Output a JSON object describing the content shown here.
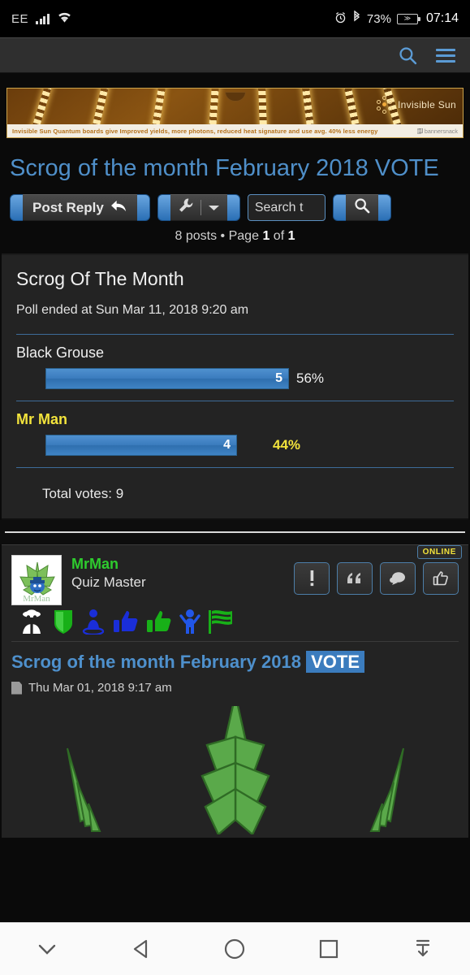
{
  "statusbar": {
    "carrier": "EE",
    "battery_percent": "73%",
    "clock": "07:14",
    "icons": [
      "signal-bars-icon",
      "wifi-icon",
      "alarm-icon",
      "bluetooth-icon",
      "battery-icon"
    ]
  },
  "navbar": {
    "search_icon": "search-icon",
    "menu_icon": "hamburger-menu-icon"
  },
  "banner": {
    "brand": "Invisible Sun",
    "tagline": "Invisible Sun Quantum boards give Improved yields, more photons, reduced heat signature and use avg. 40% less energy",
    "watermark": "bannersnack"
  },
  "page": {
    "title": "Scrog of the month February 2018 VOTE"
  },
  "toolbar": {
    "post_reply_label": "Post Reply",
    "reply_icon": "reply-arrow-icon",
    "tools_icon": "wrench-icon",
    "dropdown_icon": "chevron-down-icon",
    "search_value": "Search t",
    "search_placeholder": "Search this topic…",
    "search_button_icon": "magnifier-icon",
    "posts_count": "8 posts",
    "separator": "•",
    "page_prefix": "Page",
    "page_current": "1",
    "page_of": "of",
    "page_total": "1"
  },
  "poll": {
    "title": "Scrog Of The Month",
    "ended_text": "Poll ended at Sun Mar 11, 2018 9:20 am",
    "total_votes_label": "Total votes: 9",
    "options": [
      {
        "label": "Black Grouse",
        "votes": "5",
        "percent": "56%",
        "percent_value": 56,
        "voted": false
      },
      {
        "label": "Mr Man",
        "votes": "4",
        "percent": "44%",
        "percent_value": 44,
        "voted": true
      }
    ]
  },
  "post": {
    "author": "MrMan",
    "rank": "Quiz Master",
    "avatar_label": "MrMan",
    "online_badge": "ONLINE",
    "action_buttons": [
      {
        "name": "report-button",
        "glyph": "!"
      },
      {
        "name": "quote-button",
        "glyph": "“"
      },
      {
        "name": "comment-button",
        "glyph": "●"
      },
      {
        "name": "like-button",
        "glyph": "ὄD"
      }
    ],
    "badges": [
      "detective-icon",
      "shield-icon",
      "pedestal-person-icon",
      "thumbs-up-blue-icon",
      "thumbs-up-green-icon",
      "cheering-person-icon",
      "checkered-flag-icon"
    ],
    "subject_text": "Scrog of the month February 2018",
    "subject_tag": "VOTE",
    "date": "Thu Mar 01, 2018 9:17 am",
    "date_icon": "document-icon"
  },
  "android_nav": {
    "items": [
      "chevron-down-icon",
      "back-icon",
      "home-icon",
      "recents-icon",
      "collapse-keyboard-icon"
    ]
  },
  "colors": {
    "accent_blue": "#4f8fc9",
    "bar_blue": "#3b7cbe",
    "voted_yellow": "#f2e33c",
    "username_green": "#2ecc2e",
    "page_bg": "#0a0a0a",
    "panel_bg": "#232323"
  }
}
